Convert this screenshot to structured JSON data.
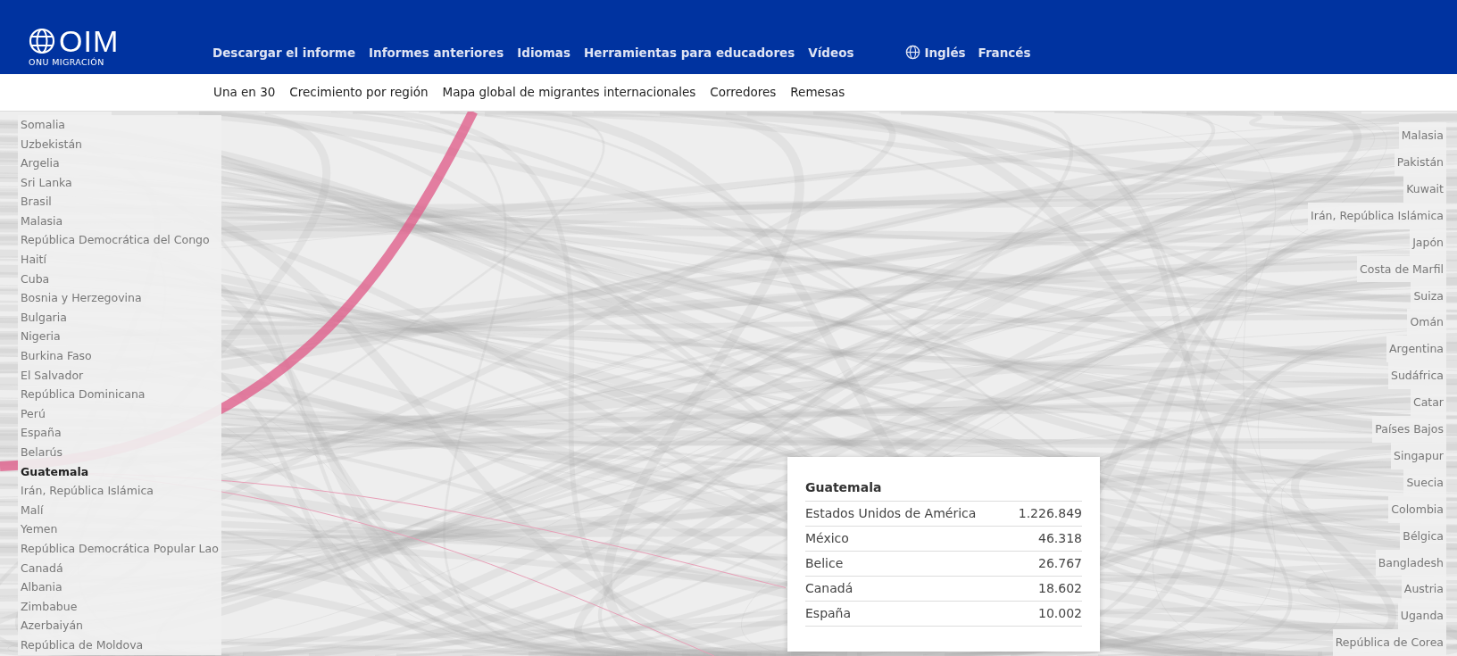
{
  "header": {
    "logo_text": "OIM",
    "logo_subtitle": "ONU MIGRACIÓN",
    "nav": [
      "Descargar el informe",
      "Informes anteriores",
      "Idiomas",
      "Herramientas para educadores",
      "Vídeos"
    ],
    "languages": [
      "Inglés",
      "Francés"
    ]
  },
  "subnav": [
    "Una en 30",
    "Crecimiento por región",
    "Mapa global de migrantes internacionales",
    "Corredores",
    "Remesas"
  ],
  "origins": [
    {
      "name": "Somalia",
      "selected": false
    },
    {
      "name": "Uzbekistán",
      "selected": false
    },
    {
      "name": "Argelia",
      "selected": false
    },
    {
      "name": "Sri Lanka",
      "selected": false
    },
    {
      "name": "Brasil",
      "selected": false
    },
    {
      "name": "Malasia",
      "selected": false
    },
    {
      "name": "República Democrática del Congo",
      "selected": false
    },
    {
      "name": "Haití",
      "selected": false
    },
    {
      "name": "Cuba",
      "selected": false
    },
    {
      "name": "Bosnia y Herzegovina",
      "selected": false
    },
    {
      "name": "Bulgaria",
      "selected": false
    },
    {
      "name": "Nigeria",
      "selected": false
    },
    {
      "name": "Burkina Faso",
      "selected": false
    },
    {
      "name": "El Salvador",
      "selected": false
    },
    {
      "name": "República Dominicana",
      "selected": false
    },
    {
      "name": "Perú",
      "selected": false
    },
    {
      "name": "España",
      "selected": false
    },
    {
      "name": "Belarús",
      "selected": false
    },
    {
      "name": "Guatemala",
      "selected": true
    },
    {
      "name": "Irán, República Islámica",
      "selected": false
    },
    {
      "name": "Malí",
      "selected": false
    },
    {
      "name": "Yemen",
      "selected": false
    },
    {
      "name": "República Democrática Popular Lao",
      "selected": false
    },
    {
      "name": "Canadá",
      "selected": false
    },
    {
      "name": "Albania",
      "selected": false
    },
    {
      "name": "Zimbabue",
      "selected": false
    },
    {
      "name": "Azerbaiyán",
      "selected": false
    },
    {
      "name": "República de Moldova",
      "selected": false
    }
  ],
  "destinations": [
    {
      "name": "Malasia"
    },
    {
      "name": "Pakistán"
    },
    {
      "name": "Kuwait"
    },
    {
      "name": "Irán, República Islámica"
    },
    {
      "name": "Japón"
    },
    {
      "name": "Costa de Marfil"
    },
    {
      "name": "Suiza"
    },
    {
      "name": "Omán"
    },
    {
      "name": "Argentina"
    },
    {
      "name": "Sudáfrica"
    },
    {
      "name": "Catar"
    },
    {
      "name": "Países Bajos"
    },
    {
      "name": "Singapur"
    },
    {
      "name": "Suecia"
    },
    {
      "name": "Colombia"
    },
    {
      "name": "Bélgica"
    },
    {
      "name": "Bangladesh"
    },
    {
      "name": "Austria"
    },
    {
      "name": "Uganda"
    },
    {
      "name": "República de Corea"
    }
  ],
  "tooltip": {
    "title": "Guatemala",
    "rows": [
      {
        "country": "Estados Unidos de América",
        "value": "1.226.849"
      },
      {
        "country": "México",
        "value": "46.318"
      },
      {
        "country": "Belice",
        "value": "26.767"
      },
      {
        "country": "Canadá",
        "value": "18.602"
      },
      {
        "country": "España",
        "value": "10.002"
      }
    ]
  }
}
